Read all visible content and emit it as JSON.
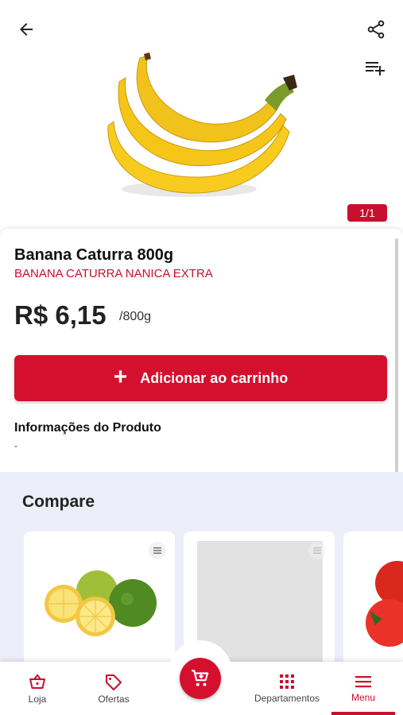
{
  "header": {
    "back_icon": "arrow-left-icon",
    "share_icon": "share-icon",
    "add_to_list_icon": "playlist-add-icon",
    "image_counter": "1/1"
  },
  "product": {
    "name": "Banana Caturra 800g",
    "description": "BANANA CATURRA NANICA EXTRA",
    "price": "R$ 6,15",
    "unit": "/800g",
    "info_title": "Informações do Produto",
    "info_text": "-"
  },
  "add_button": {
    "label": "Adicionar ao carrinho",
    "icon": "plus-icon"
  },
  "compare": {
    "title": "Compare"
  },
  "bottom_nav": {
    "items": [
      {
        "label": "Loja",
        "icon": "basket-icon"
      },
      {
        "label": "Ofertas",
        "icon": "tag-icon"
      },
      {
        "label": "Departamentos",
        "icon": "grid-icon"
      },
      {
        "label": "Menu",
        "icon": "menu-icon"
      }
    ],
    "cart_icon": "cart-icon",
    "active": "Menu"
  },
  "colors": {
    "accent": "#c8102e",
    "compare_background": "#eceef9"
  }
}
